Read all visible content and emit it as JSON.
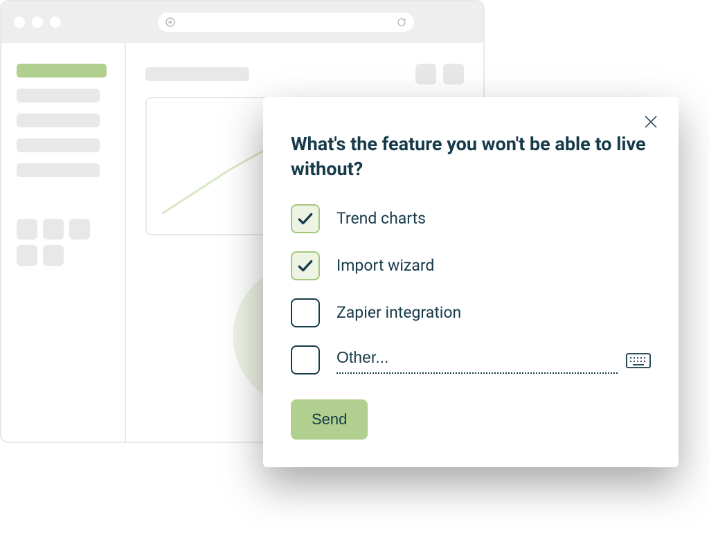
{
  "survey": {
    "question": "What's the feature you won't be able to live without?",
    "options": [
      {
        "label": "Trend charts",
        "checked": true
      },
      {
        "label": "Import wizard",
        "checked": true
      },
      {
        "label": "Zapier integration",
        "checked": false
      }
    ],
    "other_placeholder": "Other...",
    "submit_label": "Send"
  },
  "colors": {
    "accent": "#b1cf8e",
    "text": "#163a4a",
    "checkbox_fill": "#edf4e4"
  }
}
